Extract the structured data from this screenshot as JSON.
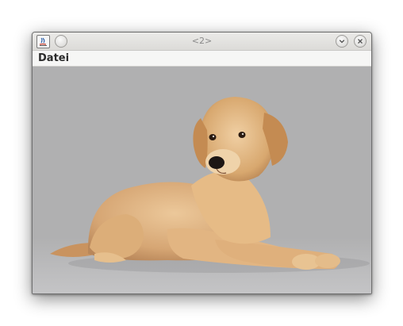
{
  "window": {
    "title": "<2>"
  },
  "menubar": {
    "items": [
      {
        "label": "Datei"
      }
    ]
  },
  "icons": {
    "app": "java-app-icon",
    "left_button": "window-menu-icon",
    "minimize": "chevron-down-icon",
    "close": "close-icon"
  },
  "content": {
    "image": "golden-retriever-puppy",
    "background": "#b0b0b1"
  }
}
